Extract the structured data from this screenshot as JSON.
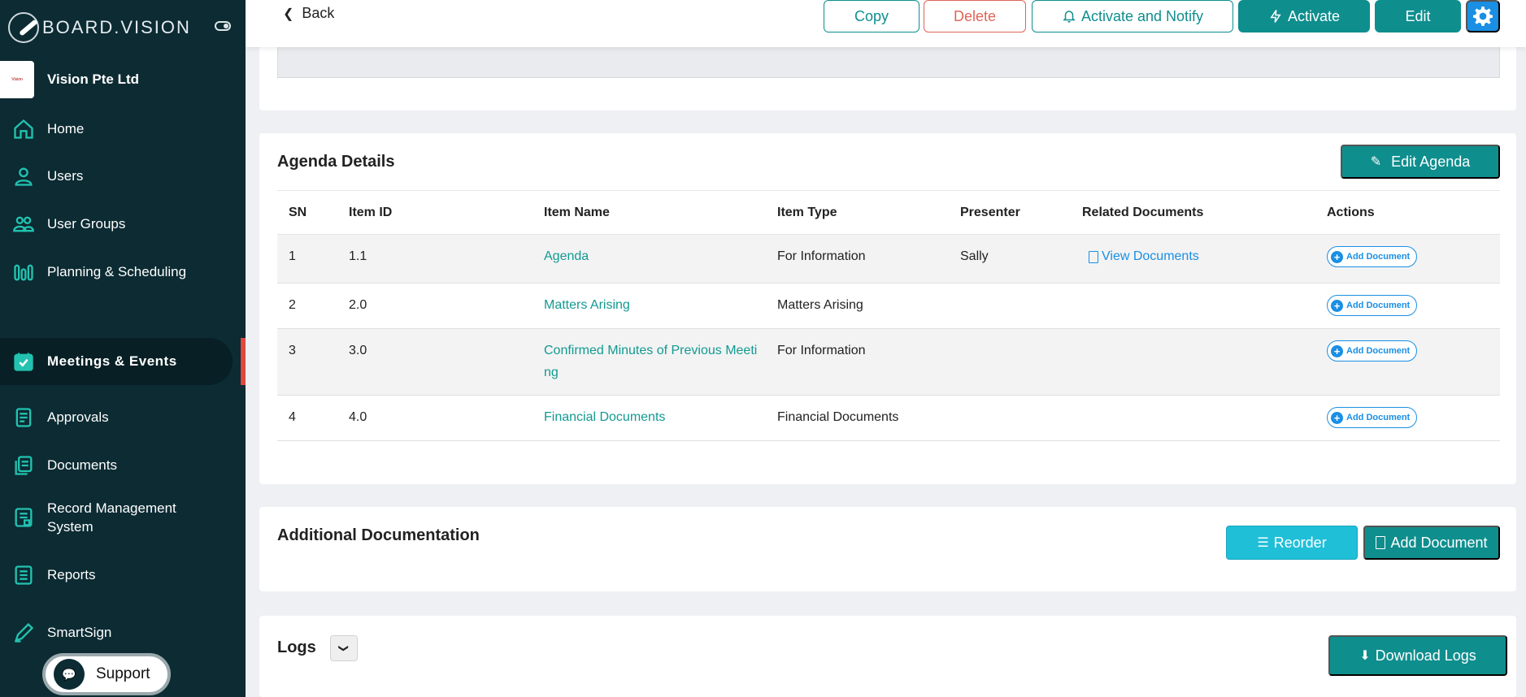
{
  "brand": {
    "name": "BOARD.VISION"
  },
  "org": {
    "name": "Vision Pte Ltd",
    "logo_text": "Vision"
  },
  "sidebar": {
    "items": [
      {
        "label": "Home",
        "icon": "home-icon"
      },
      {
        "label": "Users",
        "icon": "user-icon"
      },
      {
        "label": "User Groups",
        "icon": "user-group-icon"
      },
      {
        "label": "Planning & Scheduling",
        "icon": "bars-icon"
      },
      {
        "label": "Meetings & Events",
        "icon": "calendar-check-icon",
        "active": true
      },
      {
        "label": "Approvals",
        "icon": "approvals-icon"
      },
      {
        "label": "Documents",
        "icon": "documents-icon"
      },
      {
        "label": "Record Management System",
        "icon": "record-icon"
      },
      {
        "label": "Reports",
        "icon": "reports-icon"
      },
      {
        "label": "SmartSign",
        "icon": "pen-icon"
      }
    ]
  },
  "support": {
    "label": "Support"
  },
  "topbar": {
    "back": "Back",
    "copy": "Copy",
    "delete": "Delete",
    "activate_notify": "Activate and Notify",
    "activate": "Activate",
    "edit": "Edit"
  },
  "agenda": {
    "title": "Agenda Details",
    "edit_button": "Edit Agenda",
    "columns": [
      "SN",
      "Item ID",
      "Item Name",
      "Item Type",
      "Presenter",
      "Related Documents",
      "Actions"
    ],
    "rows": [
      {
        "sn": "1",
        "item_id": "1.1",
        "name": "Agenda",
        "type": "For Information",
        "presenter": "Sally",
        "docs": "View Documents",
        "action": "Add Document"
      },
      {
        "sn": "2",
        "item_id": "2.0",
        "name": "Matters Arising",
        "type": "Matters Arising",
        "presenter": "",
        "docs": "",
        "action": "Add Document"
      },
      {
        "sn": "3",
        "item_id": "3.0",
        "name": "Confirmed Minutes of Previous Meeti ng",
        "type": "For Information",
        "presenter": "",
        "docs": "",
        "action": "Add Document"
      },
      {
        "sn": "4",
        "item_id": "4.0",
        "name": "Financial Documents",
        "type": "Financial Documents",
        "presenter": "",
        "docs": "",
        "action": "Add Document"
      }
    ]
  },
  "additional": {
    "title": "Additional Documentation",
    "reorder": "Reorder",
    "add_document": "Add Document"
  },
  "logs": {
    "title": "Logs",
    "download": "Download Logs"
  },
  "colors": {
    "sidebar_bg": "#0c2b33",
    "accent_teal": "#0f8e8e",
    "link_blue": "#1a8fe3",
    "danger": "#e06458",
    "active_marker": "#e0483e"
  }
}
